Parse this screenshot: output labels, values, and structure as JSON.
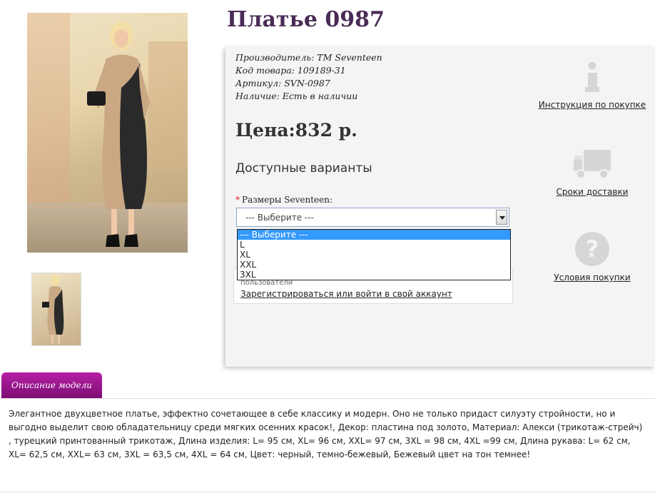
{
  "product": {
    "title": "Платье 0987",
    "manufacturer": "Производитель: TM Seventeen",
    "code": "Код товара: 109189-31",
    "article": "Артикул: SVN-0987",
    "availability": "Наличие: Есть в наличии",
    "price": "Цена:832 р."
  },
  "options": {
    "heading": "Доступные варианты",
    "size_label": "Размеры Seventeen:",
    "required_mark": "*",
    "select_value": "--- Выберите ---",
    "dropdown_options": [
      "--- Выберите ---",
      "L",
      "XL",
      "XXL",
      "3XL"
    ]
  },
  "login": {
    "partial_text": "пользователи",
    "link": "Зарегистрироваться или войти в свой аккаунт"
  },
  "sidebar": {
    "instructions": "Инструкция по покупке",
    "delivery": "Сроки доставки",
    "terms": "Условия покупки"
  },
  "description": {
    "tab": "Описание модели",
    "text": "Элегантное двухцветное платье, эффектно сочетающее в себе классику и модерн. Оно не только придаст силуэту стройности, но и выгодно выделит свою обладательницу среди мягких осенних красок!, Декор: пластина под золото, Материал: Алекси (трикотаж-стрейч) , турецкий принтованный трикотаж, Длина изделия: L= 95 см, XL= 96 см, XXL= 97 см, 3XL = 98 см, 4XL =99 см, Длина рукава: L= 62 см, XL= 62,5 см, XXL= 63 см, 3XL = 63,5 см, 4XL = 64 см, Цвет: черный, темно-бежевый, Бежевый цвет на тон темнее!"
  },
  "colors": {
    "title": "#4a2b55",
    "tab": "#9a1790",
    "dropdown_highlight": "#3399ff",
    "icons": "#d6d6d6"
  }
}
